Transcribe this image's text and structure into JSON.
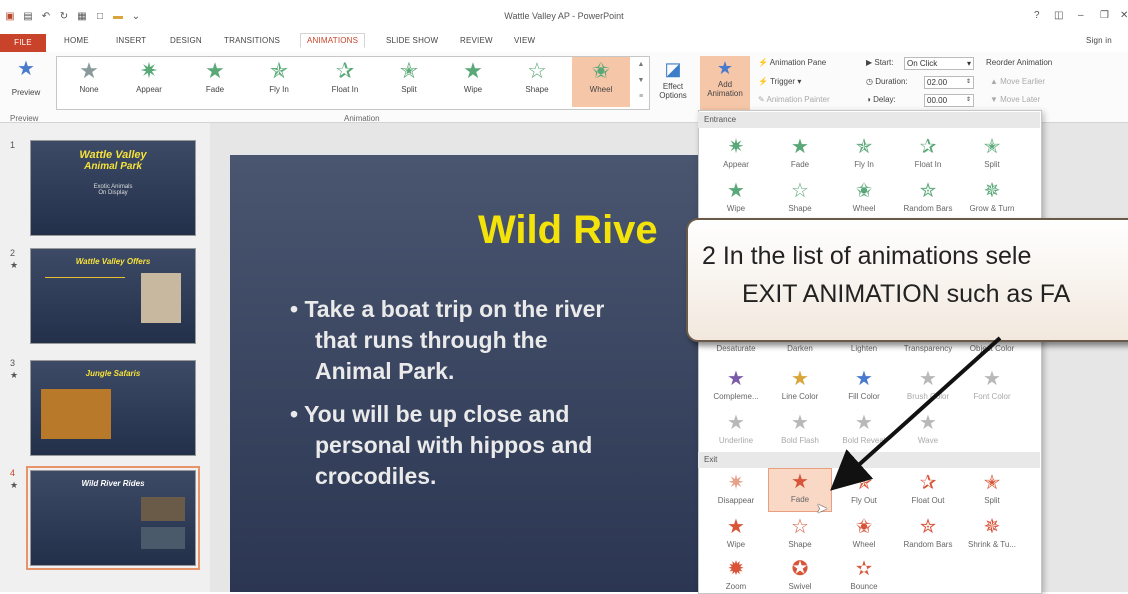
{
  "window": {
    "title": "Wattle Valley AP - PowerPoint",
    "help": "?",
    "signin": "Sign in"
  },
  "tabs": [
    "FILE",
    "HOME",
    "INSERT",
    "DESIGN",
    "TRANSITIONS",
    "ANIMATIONS",
    "SLIDE SHOW",
    "REVIEW",
    "VIEW"
  ],
  "ribbon": {
    "preview_label": "Preview",
    "preview_group": "Preview",
    "animation_group": "Animation",
    "gallery": [
      {
        "label": "None"
      },
      {
        "label": "Appear"
      },
      {
        "label": "Fade"
      },
      {
        "label": "Fly In"
      },
      {
        "label": "Float In"
      },
      {
        "label": "Split"
      },
      {
        "label": "Wipe"
      },
      {
        "label": "Shape"
      },
      {
        "label": "Wheel"
      }
    ],
    "effect_options": "Effect",
    "effect_options2": "Options",
    "add_animation": "Add",
    "add_animation2": "Animation",
    "animation_pane": "Animation Pane",
    "trigger": "Trigger",
    "animation_painter": "Animation Painter",
    "start_label": "Start:",
    "start_value": "On Click",
    "duration_label": "Duration:",
    "duration_value": "02.00",
    "delay_label": "Delay:",
    "delay_value": "00.00",
    "reorder": "Reorder Animation",
    "move_earlier": "Move Earlier",
    "move_later": "Move Later"
  },
  "slides": [
    {
      "num": "1",
      "title": "Wattle Valley",
      "title2": "Animal Park",
      "sub": "Exotic Animals",
      "sub2": "On Display"
    },
    {
      "num": "2",
      "title": "Wattle Valley Offers"
    },
    {
      "num": "3",
      "title": "Jungle Safaris"
    },
    {
      "num": "4",
      "title": "Wild River Rides"
    }
  ],
  "slide": {
    "title": "Wild Rive",
    "bullet1a": "• Take a boat trip on the river",
    "bullet1b": "that runs through the",
    "bullet1c": "Animal Park.",
    "bullet2a": "• You will be up close and",
    "bullet2b": "personal with hippos and",
    "bullet2c": "crocodiles."
  },
  "dropdown": {
    "entrance_header": "Entrance",
    "entrance": [
      "Appear",
      "Fade",
      "Fly In",
      "Float In",
      "Split",
      "Wipe",
      "Shape",
      "Wheel",
      "Random Bars",
      "Grow & Turn"
    ],
    "emphasis": [
      "Desaturate",
      "Darken",
      "Lighten",
      "Transparency",
      "Object Color",
      "Compleme...",
      "Line Color",
      "Fill Color",
      "Brush Color",
      "Font Color",
      "Underline",
      "Bold Flash",
      "Bold Reveal",
      "Wave"
    ],
    "exit_header": "Exit",
    "exit": [
      "Disappear",
      "Fade",
      "Fly Out",
      "Float Out",
      "Split",
      "Wipe",
      "Shape",
      "Wheel",
      "Random Bars",
      "Shrink & Tu...",
      "Zoom",
      "Swivel",
      "Bounce"
    ]
  },
  "callout": {
    "line1": "2  In the list of animations sele",
    "line2": "EXIT ANIMATION such as FA"
  }
}
